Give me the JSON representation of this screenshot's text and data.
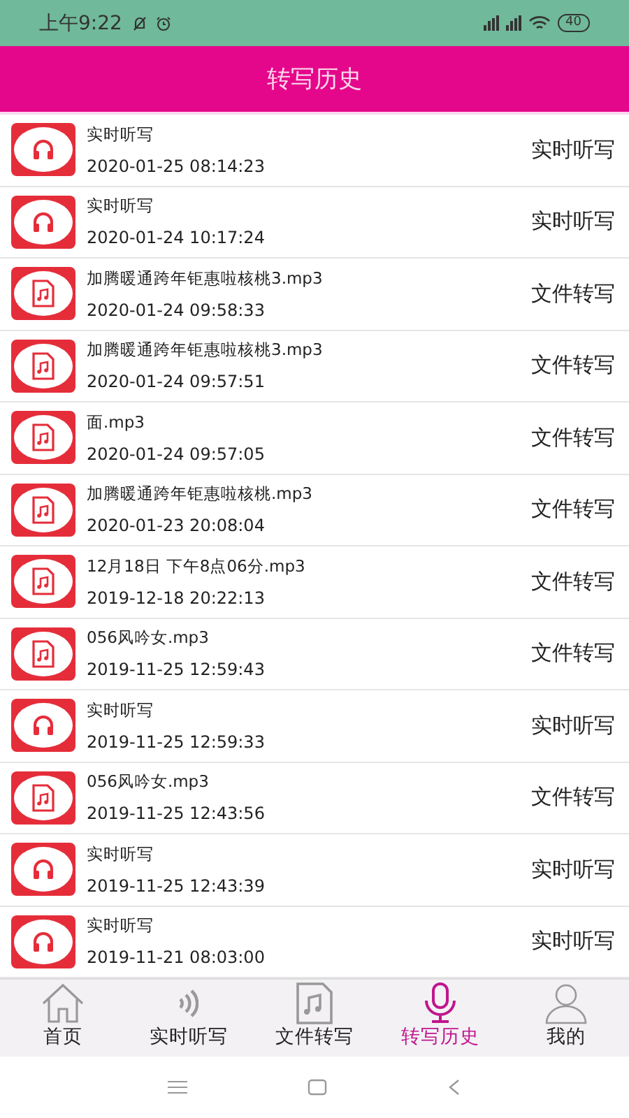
{
  "status_bar": {
    "time": "上午9:22",
    "battery": "40"
  },
  "header": {
    "title": "转写历史"
  },
  "records": [
    {
      "kind": "live",
      "name": "实时听写",
      "time": "2020-01-25 08:14:23",
      "type": "实时听写"
    },
    {
      "kind": "live",
      "name": "实时听写",
      "time": "2020-01-24 10:17:24",
      "type": "实时听写"
    },
    {
      "kind": "file",
      "name": "加腾暖通跨年钜惠啦核桃3.mp3",
      "time": "2020-01-24 09:58:33",
      "type": "文件转写"
    },
    {
      "kind": "file",
      "name": "加腾暖通跨年钜惠啦核桃3.mp3",
      "time": "2020-01-24 09:57:51",
      "type": "文件转写"
    },
    {
      "kind": "file",
      "name": "面.mp3",
      "time": "2020-01-24 09:57:05",
      "type": "文件转写"
    },
    {
      "kind": "file",
      "name": "加腾暖通跨年钜惠啦核桃.mp3",
      "time": "2020-01-23 20:08:04",
      "type": "文件转写"
    },
    {
      "kind": "file",
      "name": "12月18日 下午8点06分.mp3",
      "time": "2019-12-18 20:22:13",
      "type": "文件转写"
    },
    {
      "kind": "file",
      "name": "056风吟女.mp3",
      "time": "2019-11-25 12:59:43",
      "type": "文件转写"
    },
    {
      "kind": "live",
      "name": "实时听写",
      "time": "2019-11-25 12:59:33",
      "type": "实时听写"
    },
    {
      "kind": "file",
      "name": "056风吟女.mp3",
      "time": "2019-11-25 12:43:56",
      "type": "文件转写"
    },
    {
      "kind": "live",
      "name": "实时听写",
      "time": "2019-11-25 12:43:39",
      "type": "实时听写"
    },
    {
      "kind": "live",
      "name": "实时听写",
      "time": "2019-11-21 08:03:00",
      "type": "实时听写"
    }
  ],
  "tab_bar": [
    {
      "kind": "home",
      "label": "首页",
      "selected": false
    },
    {
      "kind": "sound",
      "label": "实时听写",
      "selected": false
    },
    {
      "kind": "file",
      "label": "文件转写",
      "selected": false
    },
    {
      "kind": "mic",
      "label": "转写历史",
      "selected": true
    },
    {
      "kind": "user",
      "label": "我的",
      "selected": false
    }
  ]
}
